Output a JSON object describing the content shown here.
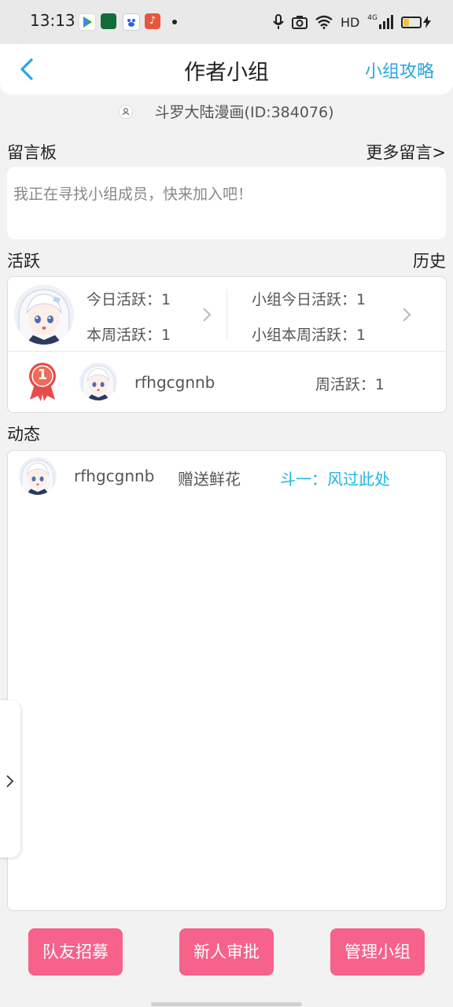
{
  "status_bar": {
    "time": "13:13",
    "network": "HD",
    "signal": "4G"
  },
  "header": {
    "title": "作者小组",
    "guide_link": "小组攻略"
  },
  "group": {
    "name_id": "斗罗大陆漫画(ID:384076)"
  },
  "message_board": {
    "title": "留言板",
    "more_link": "更多留言>",
    "placeholder_text": "我正在寻找小组成员，快来加入吧！"
  },
  "activity": {
    "title": "活跃",
    "history_link": "历史",
    "today_personal": "今日活跃：1",
    "week_personal": "本周活跃：1",
    "today_group": "小组今日活跃：1",
    "week_group": "小组本周活跃：1",
    "ranking": {
      "rank": "1",
      "username": "rfhgcgnnb",
      "weekly": "周活跃：1"
    }
  },
  "feed": {
    "title": "动态",
    "items": [
      {
        "username": "rfhgcgnnb",
        "action": "赠送鲜花",
        "detail": "斗一：风过此处"
      }
    ]
  },
  "buttons": {
    "recruit": "队友招募",
    "review": "新人审批",
    "manage": "管理小组"
  },
  "colors": {
    "accent_blue": "#2aa6e0",
    "feed_highlight": "#1fb6e0",
    "button_pink": "#f6628a",
    "medal_red": "#e94a4a"
  }
}
